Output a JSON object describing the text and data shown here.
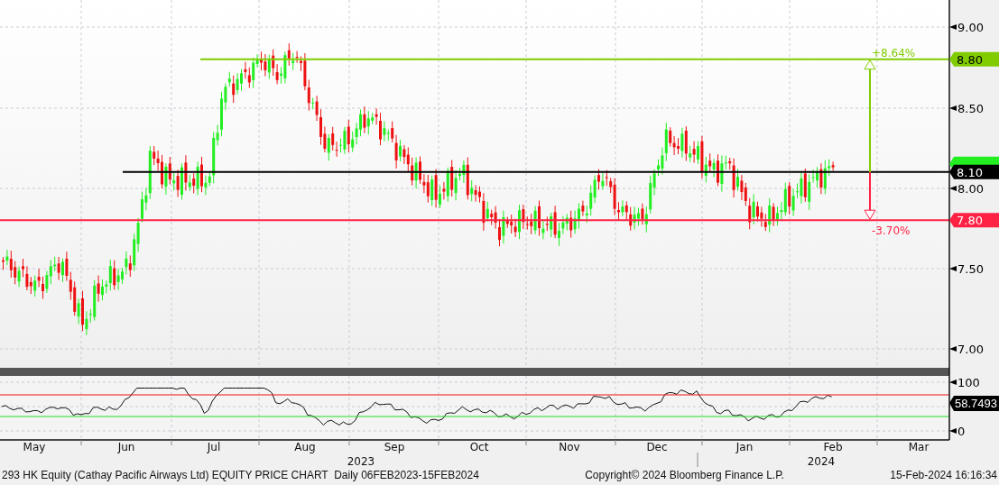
{
  "price_axis": {
    "ticks": [
      "9.00",
      "8.50",
      "8.00",
      "7.50",
      "7.00"
    ]
  },
  "level_lines": [
    {
      "label": "8.80",
      "color": "#80cc00"
    },
    {
      "color": "#22ee22"
    },
    {
      "label": "8.10",
      "color": "#000000"
    },
    {
      "label": "7.80",
      "color": "#ff2244"
    }
  ],
  "range_arrows": [
    {
      "label": "+8.64%",
      "color": "#80cc00"
    },
    {
      "label": "-3.70%",
      "color": "#ff2244"
    }
  ],
  "rsi_panel": {
    "ticks": [
      "100",
      "0"
    ],
    "value": "58.7493"
  },
  "time_axis": {
    "months": [
      "May",
      "Jun",
      "Jul",
      "Aug",
      "Sep",
      "Oct",
      "Nov",
      "Dec",
      "Jan",
      "Feb",
      "Mar"
    ],
    "years": [
      "2023",
      "2024"
    ]
  },
  "footer": {
    "title": "293 HK Equity (Cathay Pacific Airways Ltd) EQUITY PRICE CHART  Daily 06FEB2023-15FEB2024",
    "copyright": "Copyright© 2024 Bloomberg Finance L.P.",
    "timestamp": "15-Feb-2024 16:16:34"
  }
}
